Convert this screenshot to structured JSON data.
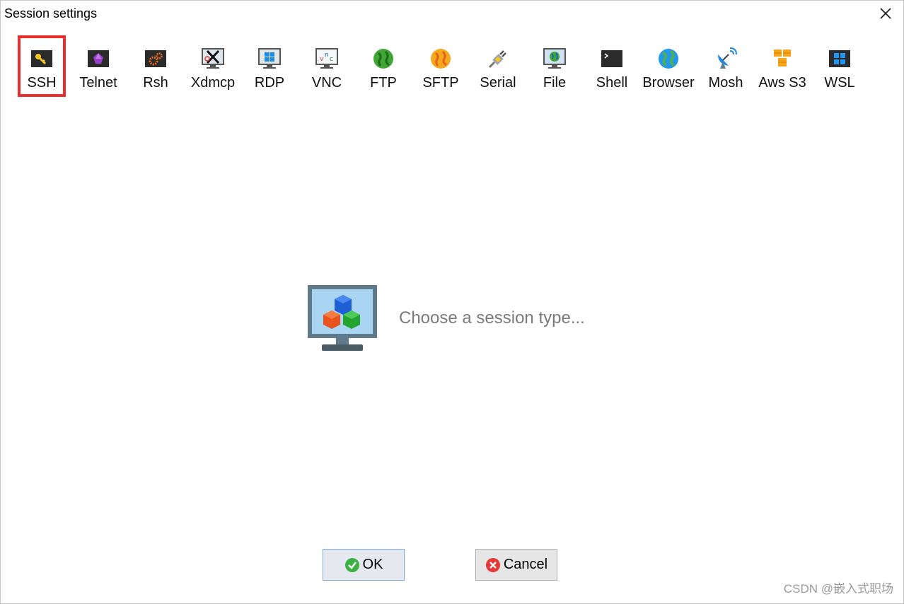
{
  "window": {
    "title": "Session settings"
  },
  "session_types": [
    {
      "id": "ssh",
      "label": "SSH",
      "icon": "key-icon",
      "selected": true
    },
    {
      "id": "telnet",
      "label": "Telnet",
      "icon": "purple-gem-icon"
    },
    {
      "id": "rsh",
      "label": "Rsh",
      "icon": "gears-icon"
    },
    {
      "id": "xdmcp",
      "label": "Xdmcp",
      "icon": "x-display-icon"
    },
    {
      "id": "rdp",
      "label": "RDP",
      "icon": "windows-monitor-icon"
    },
    {
      "id": "vnc",
      "label": "VNC",
      "icon": "vnc-monitor-icon"
    },
    {
      "id": "ftp",
      "label": "FTP",
      "icon": "green-globe-icon"
    },
    {
      "id": "sftp",
      "label": "SFTP",
      "icon": "orange-globe-icon"
    },
    {
      "id": "serial",
      "label": "Serial",
      "icon": "serial-plug-icon"
    },
    {
      "id": "file",
      "label": "File",
      "icon": "file-monitor-icon"
    },
    {
      "id": "shell",
      "label": "Shell",
      "icon": "terminal-icon"
    },
    {
      "id": "browser",
      "label": "Browser",
      "icon": "globe-icon"
    },
    {
      "id": "mosh",
      "label": "Mosh",
      "icon": "satellite-dish-icon"
    },
    {
      "id": "awss3",
      "label": "Aws S3",
      "icon": "aws-cubes-icon"
    },
    {
      "id": "wsl",
      "label": "WSL",
      "icon": "windows-logo-icon"
    }
  ],
  "main": {
    "prompt": "Choose a session type..."
  },
  "buttons": {
    "ok": "OK",
    "cancel": "Cancel"
  },
  "watermark": "CSDN @嵌入式职场",
  "colors": {
    "selection_border": "#e8312f",
    "ok_icon": "#3cb043",
    "cancel_icon": "#e53935"
  }
}
